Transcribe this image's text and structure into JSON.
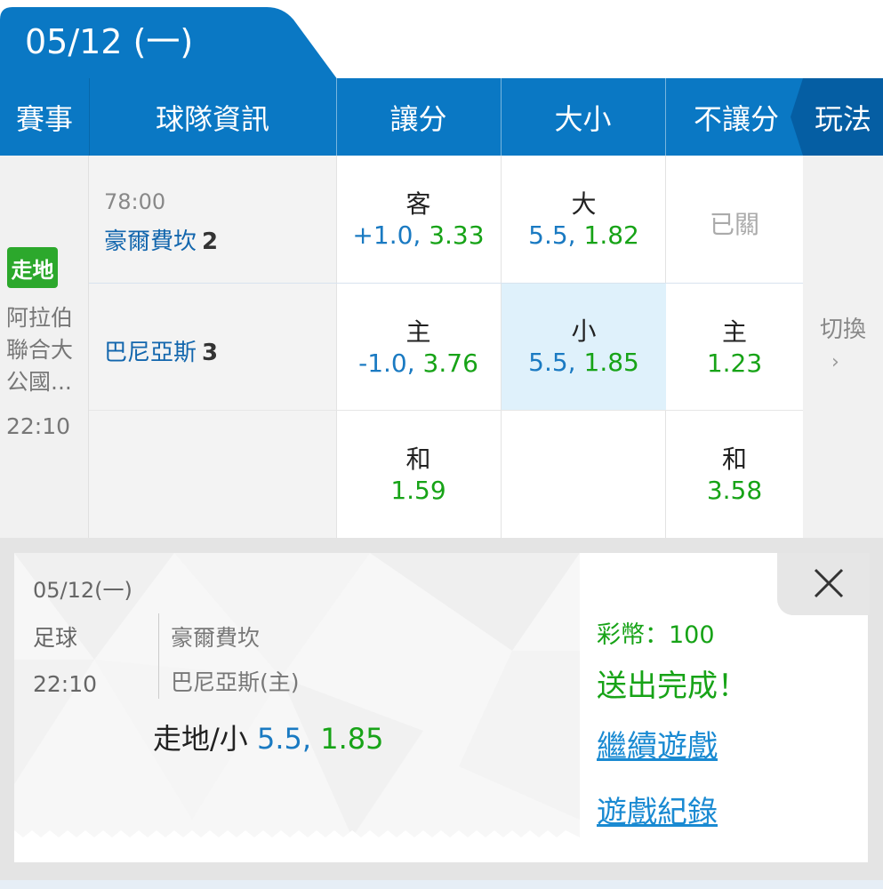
{
  "date_tab": "05/12 (一)",
  "header": {
    "event": "賽事",
    "team_info": "球隊資訊",
    "handicap": "讓分",
    "over_under": "大小",
    "no_handicap": "不讓分",
    "play_mode": "玩法"
  },
  "event": {
    "live_badge": "走地",
    "league": "阿拉伯聯合大公國...",
    "time": "22:10"
  },
  "match": {
    "game_time": "78:00",
    "away_team": "豪爾費坎",
    "away_score": "2",
    "home_team": "巴尼亞斯",
    "home_score": "3"
  },
  "odds": {
    "handicap_away_label": "客",
    "handicap_away_line": "+1.0,",
    "handicap_away_price": "3.33",
    "handicap_home_label": "主",
    "handicap_home_line": "-1.0,",
    "handicap_home_price": "3.76",
    "handicap_draw_label": "和",
    "handicap_draw_price": "1.59",
    "ou_over_label": "大",
    "ou_over_line": "5.5,",
    "ou_over_price": "1.82",
    "ou_under_label": "小",
    "ou_under_line": "5.5,",
    "ou_under_price": "1.85",
    "ml_away_status": "已關",
    "ml_home_label": "主",
    "ml_home_price": "1.23",
    "ml_draw_label": "和",
    "ml_draw_price": "3.58"
  },
  "switch": {
    "label": "切換",
    "chevron": "›"
  },
  "slip": {
    "date": "05/12(一)",
    "sport": "足球",
    "time": "22:10",
    "team1": "豪爾費坎",
    "team2": "巴尼亞斯(主)",
    "bet_type": "走地/小",
    "bet_line": "5.5,",
    "bet_price": "1.85",
    "coins": "彩幣：100",
    "status": "送出完成！",
    "continue_link": "繼續遊戲",
    "history_link": "遊戲紀錄"
  },
  "colors": {
    "header_blue": "#0a78c4",
    "tab_dark_blue": "#055ea3",
    "live_green": "#2ca82c",
    "odds_green": "#17a317",
    "odds_blue": "#1a7ac2",
    "selected_bg": "#dff1fb",
    "link_blue": "#1a8ad2"
  }
}
